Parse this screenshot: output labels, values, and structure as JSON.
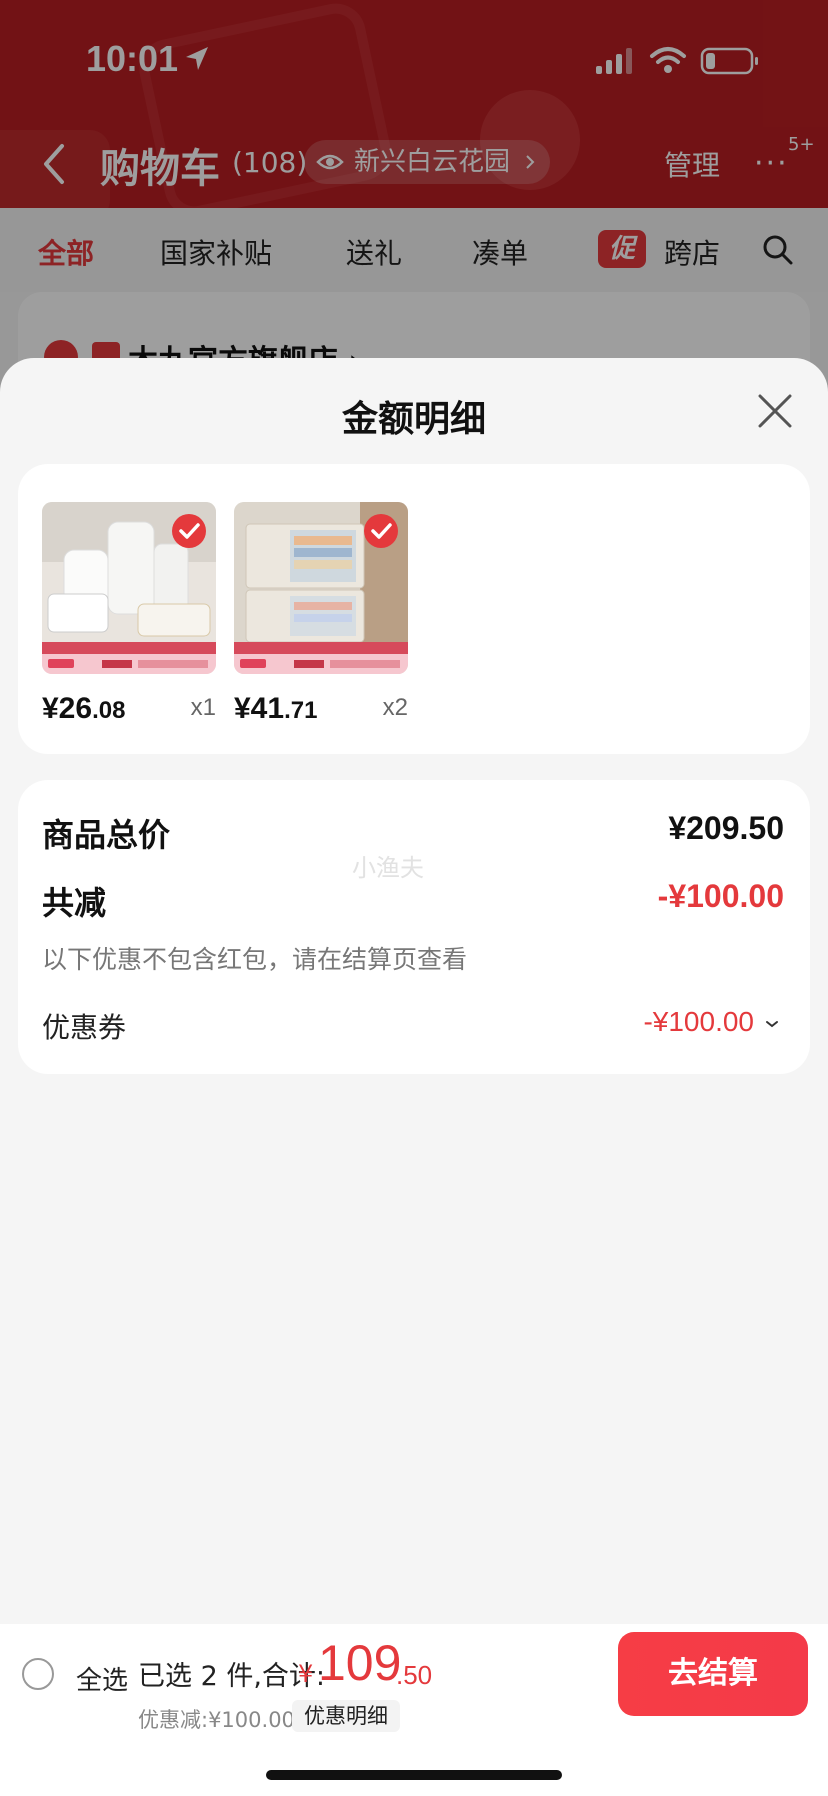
{
  "status_bar": {
    "time": "10:01"
  },
  "nav": {
    "title": "购物车",
    "count": "(108)",
    "location": "新兴白云花园",
    "manage": "管理",
    "more": "···",
    "badge": "5+"
  },
  "tabs": {
    "all": "全部",
    "subsidy": "国家补贴",
    "gift": "送礼",
    "bundle": "凑单",
    "promo_tag": "促",
    "cross_store": "跨店"
  },
  "background_store": {
    "name": "木九官方旗舰店 ›"
  },
  "sheet": {
    "title": "金额明细",
    "items": [
      {
        "price_int": "¥26",
        "price_dec": ".08",
        "qty": "x1"
      },
      {
        "price_int": "¥41",
        "price_dec": ".71",
        "qty": "x2"
      }
    ],
    "summary": {
      "total_label": "商品总价",
      "total_value": "¥209.50",
      "reduce_label": "共减",
      "reduce_value": "-¥100.00",
      "note": "以下优惠不包含红包，请在结算页查看",
      "coupon_label": "优惠券",
      "coupon_value": "-¥100.00",
      "watermark": "小渔夫"
    }
  },
  "bottom_bar": {
    "select_all": "全选",
    "selected_text": "已选 2 件,合计:",
    "total_currency": "¥",
    "total_int": "109",
    "total_dec": ".50",
    "discount_text": "优惠减:¥100.00",
    "discount_detail": "优惠明细",
    "checkout": "去结算"
  },
  "colors": {
    "brand_red": "#e4393c",
    "header_red": "#b91e22"
  }
}
